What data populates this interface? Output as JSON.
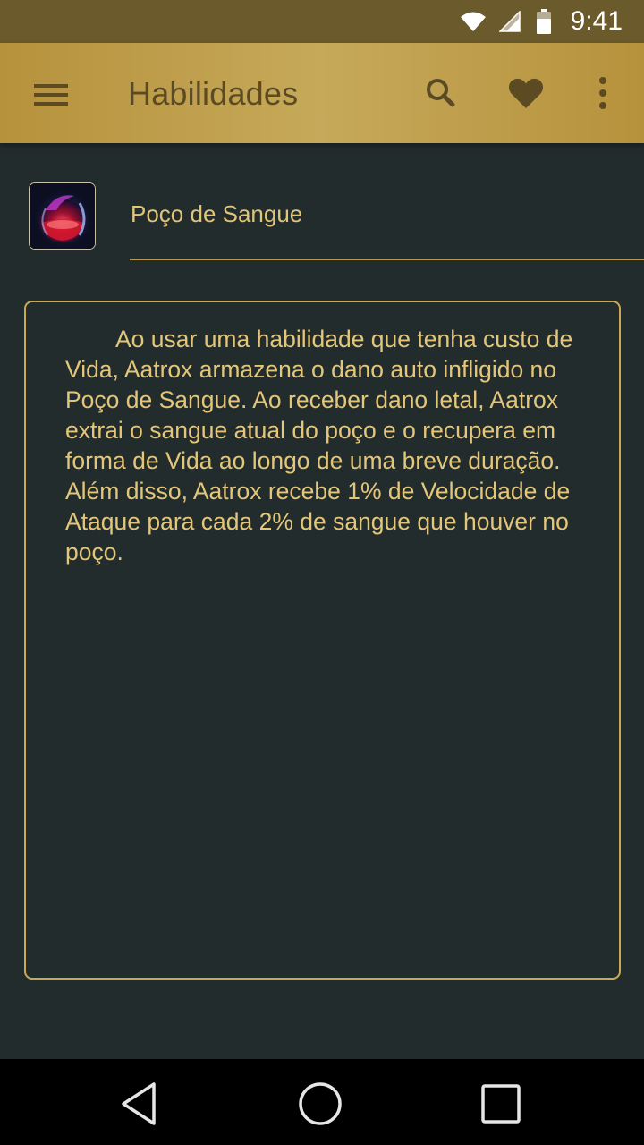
{
  "status_bar": {
    "time": "9:41",
    "icons": [
      "wifi-icon",
      "signal-icon",
      "battery-icon"
    ]
  },
  "app_bar": {
    "title": "Habilidades",
    "icons": [
      "menu-icon",
      "search-icon",
      "heart-icon",
      "more-vert-icon"
    ]
  },
  "ability": {
    "name": "Poço de Sangue",
    "icon": "blood-well-ability-icon",
    "description": "Ao usar uma habilidade que tenha custo de Vida, Aatrox armazena o dano auto infligido no Poço de Sangue. Ao receber dano letal, Aatrox extrai o sangue atual do poço e o recupera em forma de Vida ao longo de uma breve duração. Além disso, Aatrox recebe 1% de Velocidade de Ataque para cada 2% de sangue que houver no poço."
  },
  "nav_bar": {
    "icons": [
      "back-icon",
      "home-icon",
      "recents-icon"
    ]
  },
  "colors": {
    "app_bar": "#c0a04c",
    "status_bar": "#6b5a2c",
    "background": "#222c2d",
    "accent_text": "#e3c679",
    "border": "#c9a955"
  }
}
